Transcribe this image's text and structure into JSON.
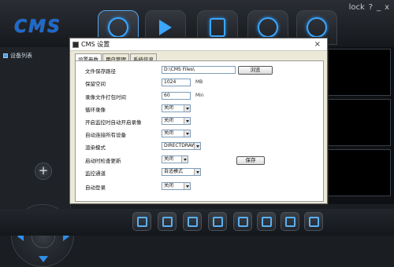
{
  "app": {
    "logo_text": "CMS"
  },
  "top_nav": [
    {
      "name": "live-view",
      "icon": "camera-reel-icon"
    },
    {
      "name": "playback",
      "icon": "play-icon"
    },
    {
      "name": "log",
      "icon": "document-edit-icon"
    },
    {
      "name": "settings",
      "icon": "gear-icon"
    },
    {
      "name": "logout",
      "icon": "power-icon"
    }
  ],
  "window_controls": [
    "lock",
    "?",
    "_",
    "x"
  ],
  "sidebar": {
    "device_list_label": "设备列表",
    "add_label": "+"
  },
  "dialog": {
    "title": "CMS 设置",
    "close": "×",
    "tabs": [
      "设置参数",
      "用户管理",
      "系统信息"
    ],
    "rows": {
      "save_path": {
        "label": "文件保存路径",
        "value": "D:\\CMS Files\\",
        "browse_label": "浏览"
      },
      "reserved_space": {
        "label": "保留空间",
        "value": "1024",
        "unit": "MB"
      },
      "package_time": {
        "label": "录像文件打包时间",
        "value": "60",
        "unit": "Min"
      },
      "loop_record": {
        "label": "循环录像",
        "value": "关闭"
      },
      "auto_record": {
        "label": "开启监控时自动开启录像",
        "value": "关闭"
      },
      "auto_connect": {
        "label": "自动连接所有设备",
        "value": "关闭"
      },
      "render_mode": {
        "label": "渲染模式",
        "value": "DIRECTDRAW"
      },
      "auto_update": {
        "label": "启动时检查更新",
        "value": "关闭"
      },
      "monitor_channel": {
        "label": "监控通道",
        "value": "自适模式"
      },
      "auto_login": {
        "label": "自动登录",
        "value": "关闭"
      }
    },
    "save_label": "保存"
  }
}
